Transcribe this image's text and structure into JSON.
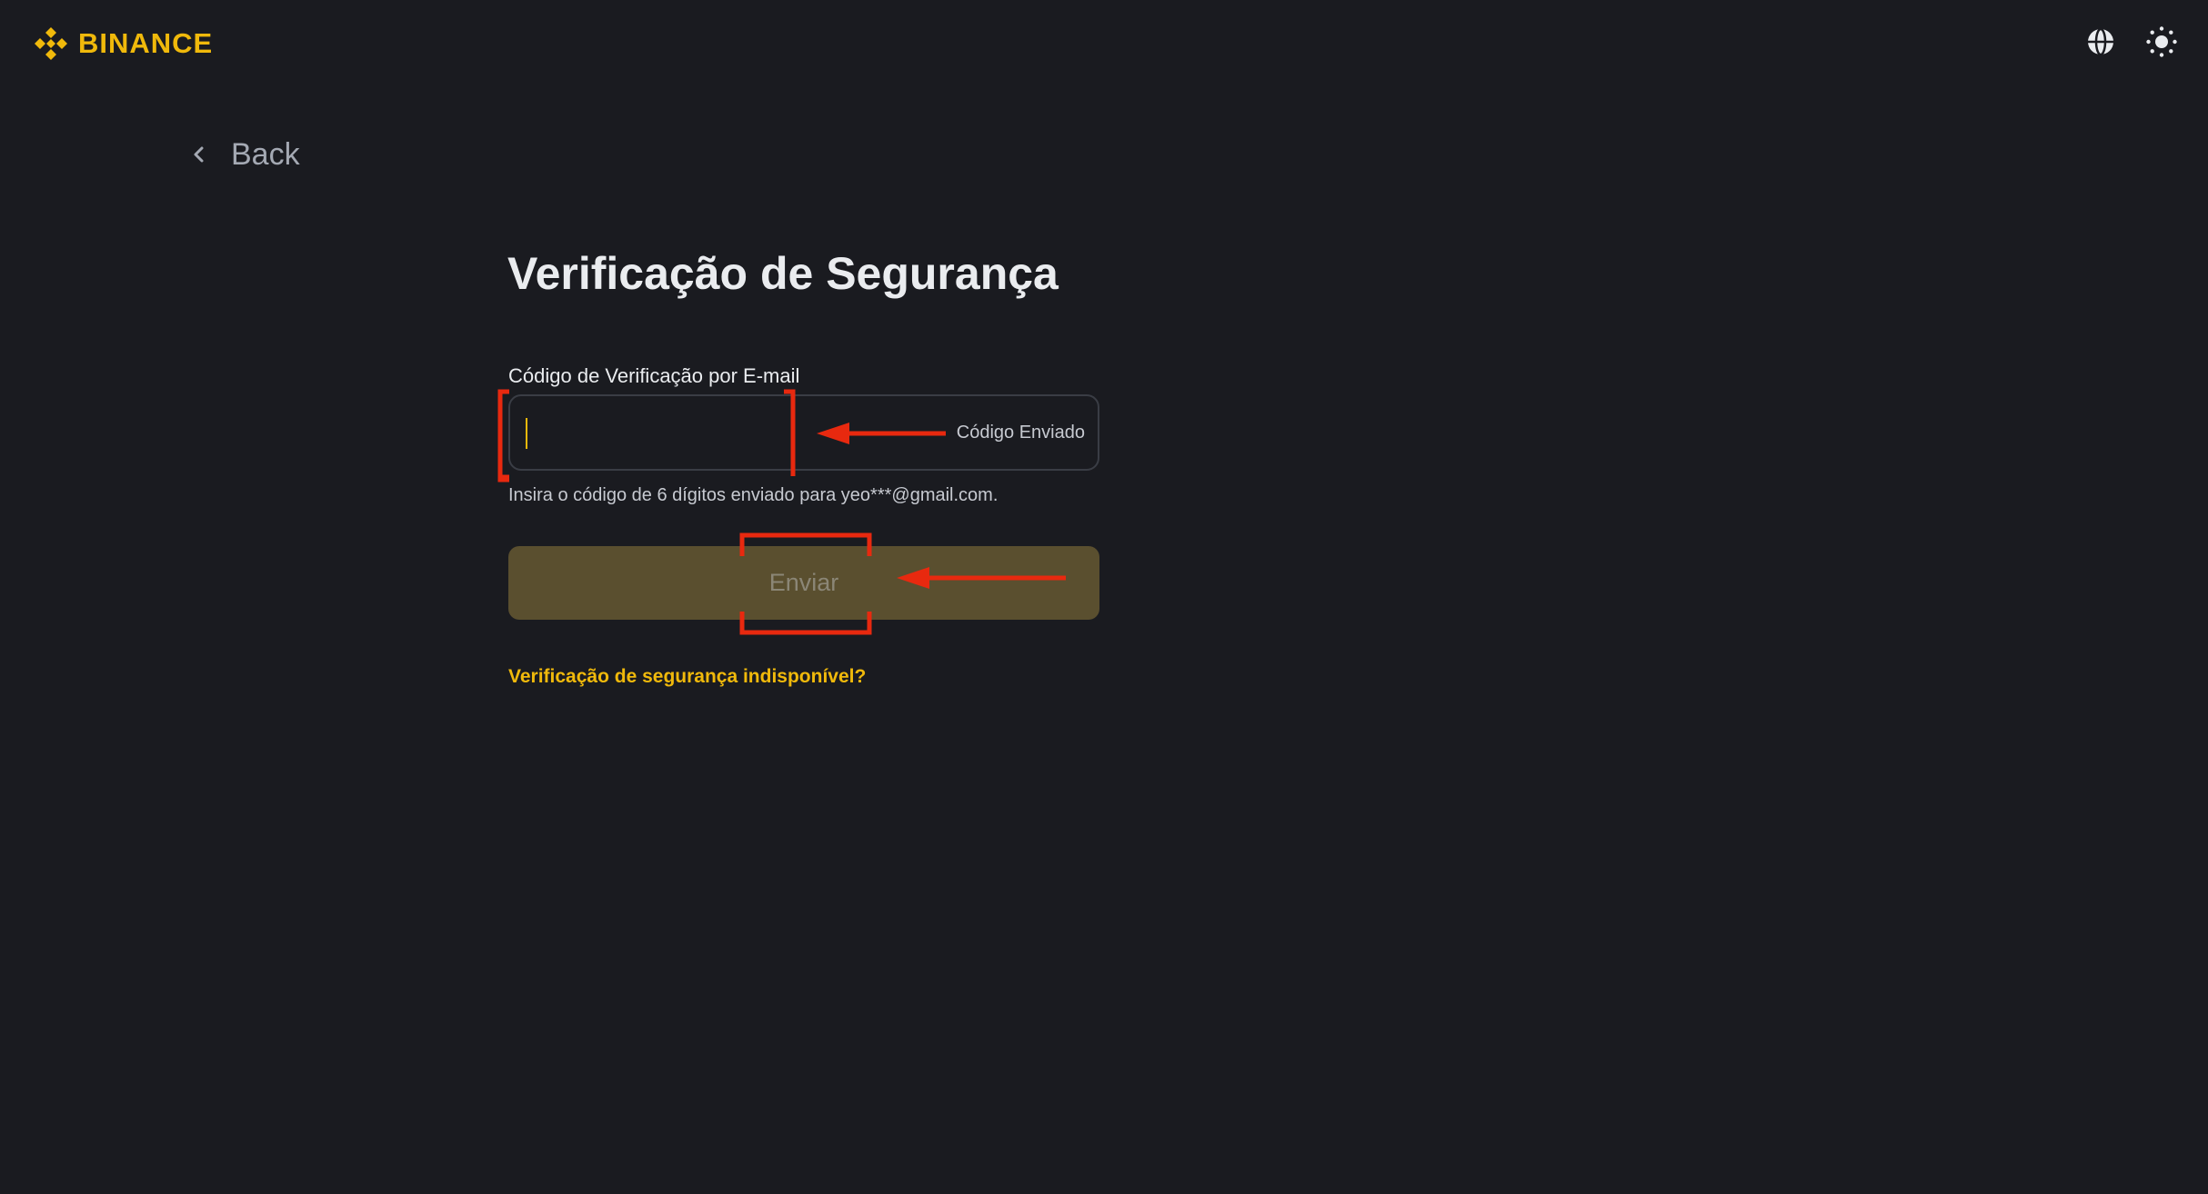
{
  "header": {
    "brand": "BINANCE",
    "brand_color": "#f0b90b",
    "icons": [
      "globe-icon",
      "theme-sun-icon"
    ]
  },
  "nav": {
    "back_label": "Back"
  },
  "page": {
    "title": "Verificação de Segurança"
  },
  "form": {
    "field_label": "Código de Verificação por E-mail",
    "input_value": "",
    "code_status": "Código Enviado",
    "helper_text": "Insira o código de 6 dígitos enviado para yeo***@gmail.com.",
    "submit_label": "Enviar",
    "submit_disabled": true
  },
  "links": {
    "unavailable": "Verificação de segurança indisponível?"
  },
  "annotations": {
    "color": "#e8290f",
    "items": [
      "input-highlight-box",
      "code-sent-arrow",
      "submit-highlight-box",
      "submit-arrow"
    ]
  }
}
